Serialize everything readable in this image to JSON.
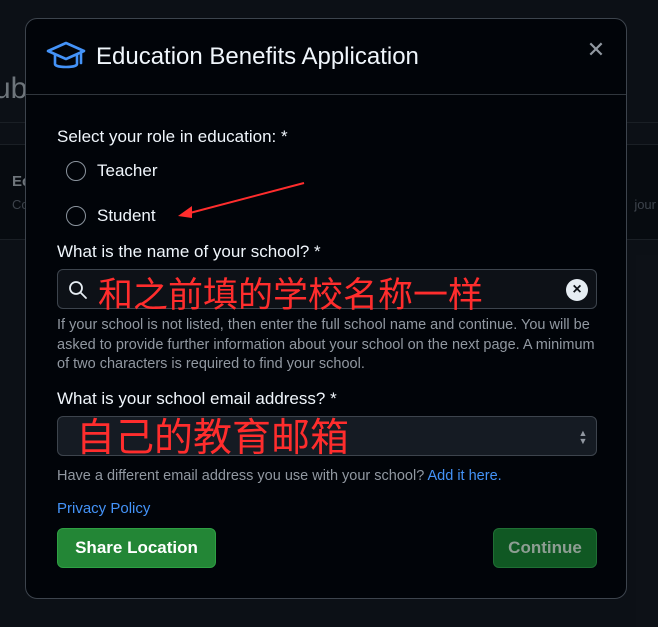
{
  "background": {
    "page_title_fragment": "ub",
    "card_title_fragment": "Ec",
    "card_sub_fragment": "Co",
    "card_right_fragment": "jour"
  },
  "dialog": {
    "title": "Education Benefits Application",
    "icon": "graduation-cap-icon",
    "close_icon": "close-icon",
    "close_glyph": "✕"
  },
  "role": {
    "label": "Select your role in education: *",
    "options": [
      "Teacher",
      "Student"
    ]
  },
  "school": {
    "label": "What is the name of your school? *",
    "value": "和之前填的学校名称一样",
    "clear_glyph": "×",
    "help": "If your school is not listed, then enter the full school name and continue. You will be asked to provide further information about your school on the next page. A minimum of two characters is required to find your school."
  },
  "email": {
    "label": "What is your school email address? *",
    "value": "自己的教育邮箱",
    "note": "Have a different email address you use with your school?",
    "note_link": "Add it here."
  },
  "privacy_link": "Privacy Policy",
  "buttons": {
    "share": "Share Location",
    "continue": "Continue"
  },
  "colors": {
    "accent_blue": "#4493f8",
    "primary_green": "#238636",
    "annotation_red": "#ff2d2d"
  }
}
